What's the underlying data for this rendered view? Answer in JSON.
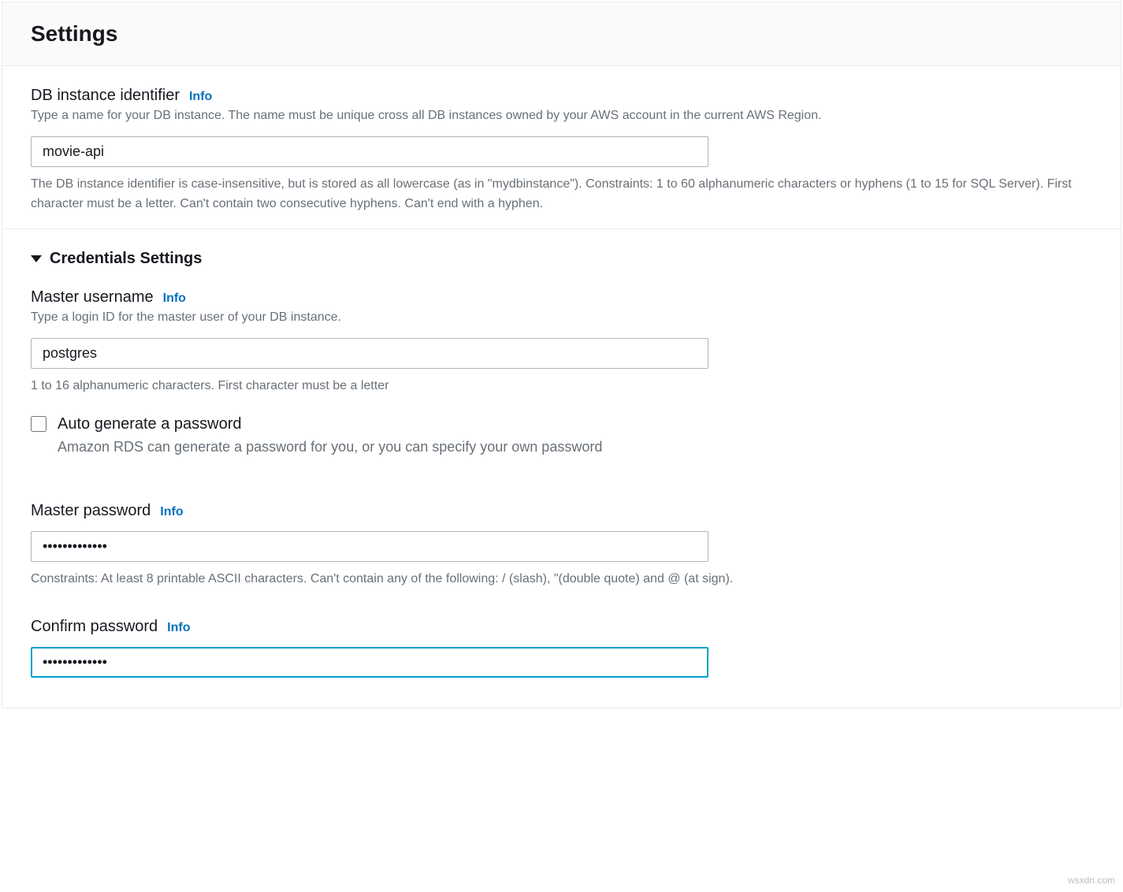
{
  "header": {
    "title": "Settings"
  },
  "db_identifier": {
    "label": "DB instance identifier",
    "info": "Info",
    "help": "Type a name for your DB instance. The name must be unique cross all DB instances owned by your AWS account in the current AWS Region.",
    "value": "movie-api",
    "constraints": "The DB instance identifier is case-insensitive, but is stored as all lowercase (as in \"mydbinstance\"). Constraints: 1 to 60 alphanumeric characters or hyphens (1 to 15 for SQL Server). First character must be a letter. Can't contain two consecutive hyphens. Can't end with a hyphen."
  },
  "credentials": {
    "section_title": "Credentials Settings",
    "master_username": {
      "label": "Master username",
      "info": "Info",
      "help": "Type a login ID for the master user of your DB instance.",
      "value": "postgres",
      "constraints": "1 to 16 alphanumeric characters. First character must be a letter"
    },
    "auto_generate": {
      "label": "Auto generate a password",
      "sub": "Amazon RDS can generate a password for you, or you can specify your own password",
      "checked": false
    },
    "master_password": {
      "label": "Master password",
      "info": "Info",
      "value": "•••••••••••••",
      "constraints": "Constraints: At least 8 printable ASCII characters. Can't contain any of the following: / (slash), \"(double quote) and @ (at sign)."
    },
    "confirm_password": {
      "label": "Confirm password",
      "info": "Info",
      "value": "•••••••••••••"
    }
  },
  "watermark": "wsxdn.com"
}
